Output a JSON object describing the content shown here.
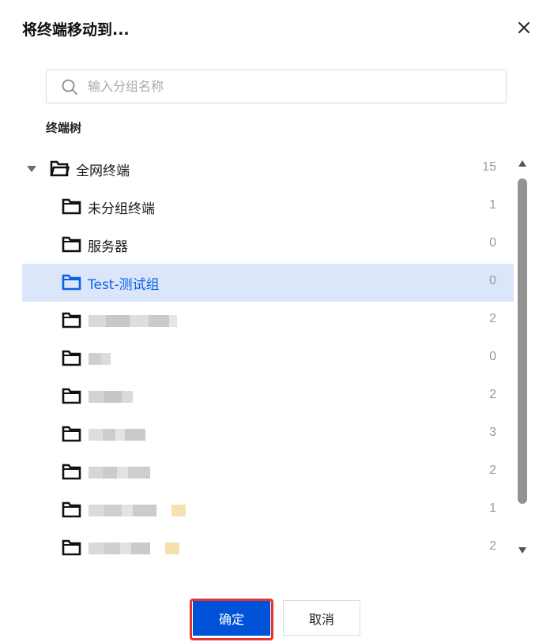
{
  "dialog": {
    "title": "将终端移动到..."
  },
  "search": {
    "placeholder": "输入分组名称",
    "value": ""
  },
  "tree": {
    "label": "终端树",
    "root": {
      "label": "全网终端",
      "count": "15",
      "expanded": true
    },
    "children": [
      {
        "label": "未分组终端",
        "count": "1",
        "selected": false,
        "blurred": false
      },
      {
        "label": "服务器",
        "count": "0",
        "selected": false,
        "blurred": false
      },
      {
        "label": "Test-测试组",
        "count": "0",
        "selected": true,
        "blurred": false
      },
      {
        "label": "",
        "count": "2",
        "selected": false,
        "blurred": true
      },
      {
        "label": "",
        "count": "0",
        "selected": false,
        "blurred": true
      },
      {
        "label": "",
        "count": "2",
        "selected": false,
        "blurred": true
      },
      {
        "label": "",
        "count": "3",
        "selected": false,
        "blurred": true
      },
      {
        "label": "",
        "count": "2",
        "selected": false,
        "blurred": true
      },
      {
        "label": "",
        "count": "1",
        "selected": false,
        "blurred": true
      },
      {
        "label": "",
        "count": "2",
        "selected": false,
        "blurred": true
      }
    ]
  },
  "footer": {
    "confirm_label": "确定",
    "cancel_label": "取消"
  },
  "colors": {
    "primary": "#0052d9",
    "selected_bg": "#dbe6fb",
    "selected_text": "#0a5fe8",
    "highlight_outline": "#e8322d"
  }
}
